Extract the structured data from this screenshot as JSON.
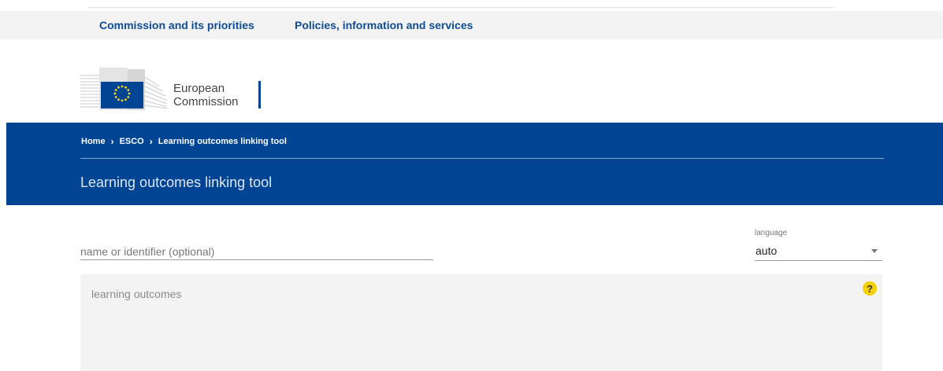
{
  "top_nav": {
    "items": [
      {
        "label": "Commission and its priorities"
      },
      {
        "label": "Policies, information and services"
      }
    ]
  },
  "logo": {
    "line1": "European",
    "line2": "Commission"
  },
  "breadcrumb": {
    "items": [
      {
        "label": "Home"
      },
      {
        "label": "ESCO"
      },
      {
        "label": "Learning outcomes linking tool"
      }
    ],
    "separator": "›"
  },
  "page": {
    "title": "Learning outcomes linking tool"
  },
  "form": {
    "name_field": {
      "placeholder": "name or identifier (optional)",
      "value": ""
    },
    "language": {
      "label": "language",
      "selected": "auto"
    },
    "learning_outcomes": {
      "placeholder": "learning outcomes",
      "value": "",
      "help_icon": "question-mark-icon",
      "help_glyph": "?"
    }
  },
  "colors": {
    "brand_blue": "#004494",
    "link_blue": "#0e4c96",
    "help_yellow": "#f5d000"
  }
}
